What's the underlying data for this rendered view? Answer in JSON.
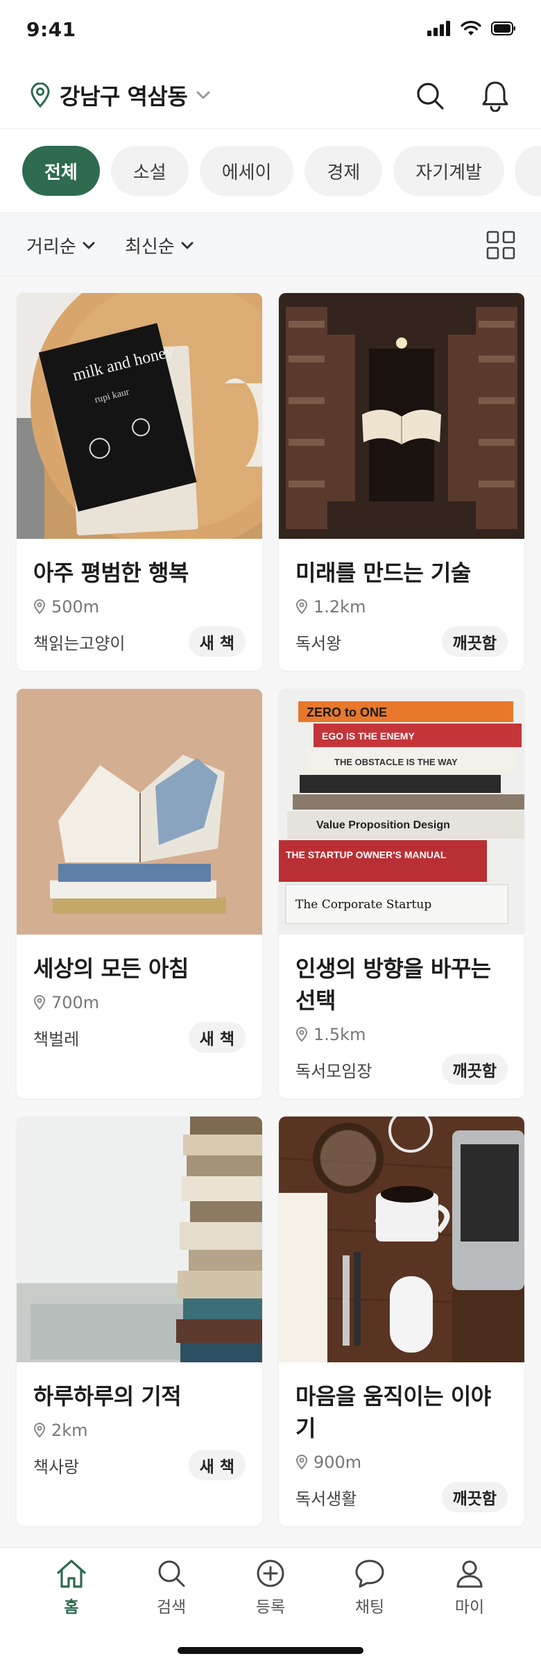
{
  "status_bar": {
    "time": "9:41"
  },
  "header": {
    "location": "강남구 역삼동"
  },
  "categories": [
    {
      "label": "전체",
      "active": true
    },
    {
      "label": "소설",
      "active": false
    },
    {
      "label": "에세이",
      "active": false
    },
    {
      "label": "경제",
      "active": false
    },
    {
      "label": "자기계발",
      "active": false
    }
  ],
  "filters": {
    "distance_sort": "거리순",
    "recent_sort": "최신순"
  },
  "books": [
    {
      "title": "아주 평범한 행복",
      "distance": "500m",
      "seller": "책읽는고양이",
      "condition": "새 책"
    },
    {
      "title": "미래를 만드는 기술",
      "distance": "1.2km",
      "seller": "독서왕",
      "condition": "깨끗함"
    },
    {
      "title": "세상의 모든 아침",
      "distance": "700m",
      "seller": "책벌레",
      "condition": "새 책"
    },
    {
      "title": "인생의 방향을 바꾸는 선택",
      "distance": "1.5km",
      "seller": "독서모임장",
      "condition": "깨끗함"
    },
    {
      "title": "하루하루의 기적",
      "distance": "2km",
      "seller": "책사랑",
      "condition": "새 책"
    },
    {
      "title": "마음을 움직이는 이야기",
      "distance": "900m",
      "seller": "독서생활",
      "condition": "깨끗함"
    }
  ],
  "cover_texts": {
    "book1_title": "milk and honey",
    "book1_author": "rupi kaur",
    "book4_spines": [
      "ZERO to ONE",
      "EGO IS THE ENEMY",
      "THE OBSTACLE IS THE WAY",
      "Value Proposition Design",
      "THE STARTUP OWNER'S MANUAL",
      "The Corporate Startup"
    ]
  },
  "tabbar": {
    "items": [
      {
        "label": "홈",
        "icon": "home-icon",
        "active": true
      },
      {
        "label": "검색",
        "icon": "search-icon",
        "active": false
      },
      {
        "label": "등록",
        "icon": "add-circle-icon",
        "active": false
      },
      {
        "label": "채팅",
        "icon": "chat-icon",
        "active": false
      },
      {
        "label": "마이",
        "icon": "profile-icon",
        "active": false
      }
    ]
  },
  "colors": {
    "accent": "#2e6b4f",
    "chip_bg": "#f1f2f1",
    "feed_bg": "#f7f7f7"
  }
}
